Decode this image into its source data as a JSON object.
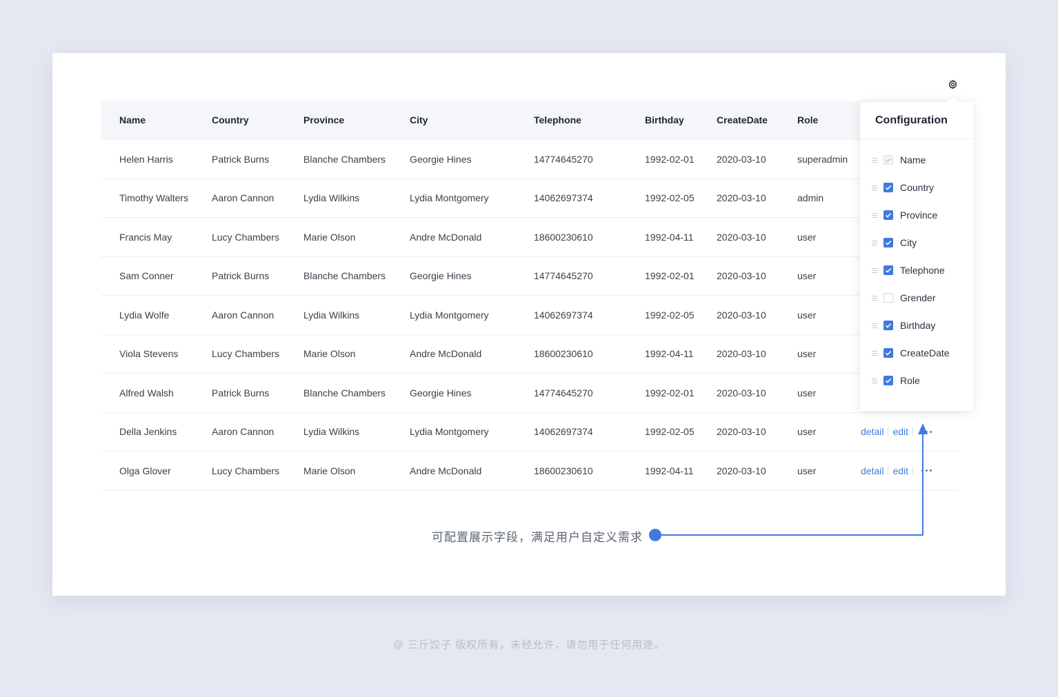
{
  "table": {
    "columns": [
      "Name",
      "Country",
      "Province",
      "City",
      "Telephone",
      "Birthday",
      "CreateDate",
      "Role"
    ],
    "rows": [
      [
        "Helen Harris",
        "Patrick Burns",
        "Blanche Chambers",
        "Georgie Hines",
        "14774645270",
        "1992-02-01",
        "2020-03-10",
        "superadmin"
      ],
      [
        "Timothy Walters",
        "Aaron Cannon",
        "Lydia Wilkins",
        "Lydia Montgomery",
        "14062697374",
        "1992-02-05",
        "2020-03-10",
        "admin"
      ],
      [
        "Francis May",
        "Lucy Chambers",
        "Marie Olson",
        "Andre McDonald",
        "18600230610",
        "1992-04-11",
        "2020-03-10",
        "user"
      ],
      [
        "Sam Conner",
        "Patrick Burns",
        "Blanche Chambers",
        "Georgie Hines",
        "14774645270",
        "1992-02-01",
        "2020-03-10",
        "user"
      ],
      [
        "Lydia Wolfe",
        "Aaron Cannon",
        "Lydia Wilkins",
        "Lydia Montgomery",
        "14062697374",
        "1992-02-05",
        "2020-03-10",
        "user"
      ],
      [
        "Viola Stevens",
        "Lucy Chambers",
        "Marie Olson",
        "Andre McDonald",
        "18600230610",
        "1992-04-11",
        "2020-03-10",
        "user"
      ],
      [
        "Alfred Walsh",
        "Patrick Burns",
        "Blanche Chambers",
        "Georgie Hines",
        "14774645270",
        "1992-02-01",
        "2020-03-10",
        "user"
      ],
      [
        "Della Jenkins",
        "Aaron Cannon",
        "Lydia Wilkins",
        "Lydia Montgomery",
        "14062697374",
        "1992-02-05",
        "2020-03-10",
        "user"
      ],
      [
        "Olga Glover",
        "Lucy Chambers",
        "Marie Olson",
        "Andre McDonald",
        "18600230610",
        "1992-04-11",
        "2020-03-10",
        "user"
      ]
    ],
    "actions": {
      "detail": "detail",
      "edit": "edit"
    }
  },
  "config_popover": {
    "title": "Configuration",
    "items": [
      {
        "label": "Name",
        "state": "disabled"
      },
      {
        "label": "Country",
        "state": "checked"
      },
      {
        "label": "Province",
        "state": "checked"
      },
      {
        "label": "City",
        "state": "checked"
      },
      {
        "label": "Telephone",
        "state": "checked"
      },
      {
        "label": "Grender",
        "state": "unchecked"
      },
      {
        "label": "Birthday",
        "state": "checked"
      },
      {
        "label": "CreateDate",
        "state": "checked"
      },
      {
        "label": "Role",
        "state": "checked"
      }
    ]
  },
  "annotation": "可配置展示字段，满足用户自定义需求",
  "footer": "@ 三斤饺子  版权所有，未经允许，请勿用于任何用途。",
  "colors": {
    "accent": "#3f7ae0",
    "background": "#e4e8f2"
  },
  "icons": {
    "settings": "gear-icon"
  }
}
